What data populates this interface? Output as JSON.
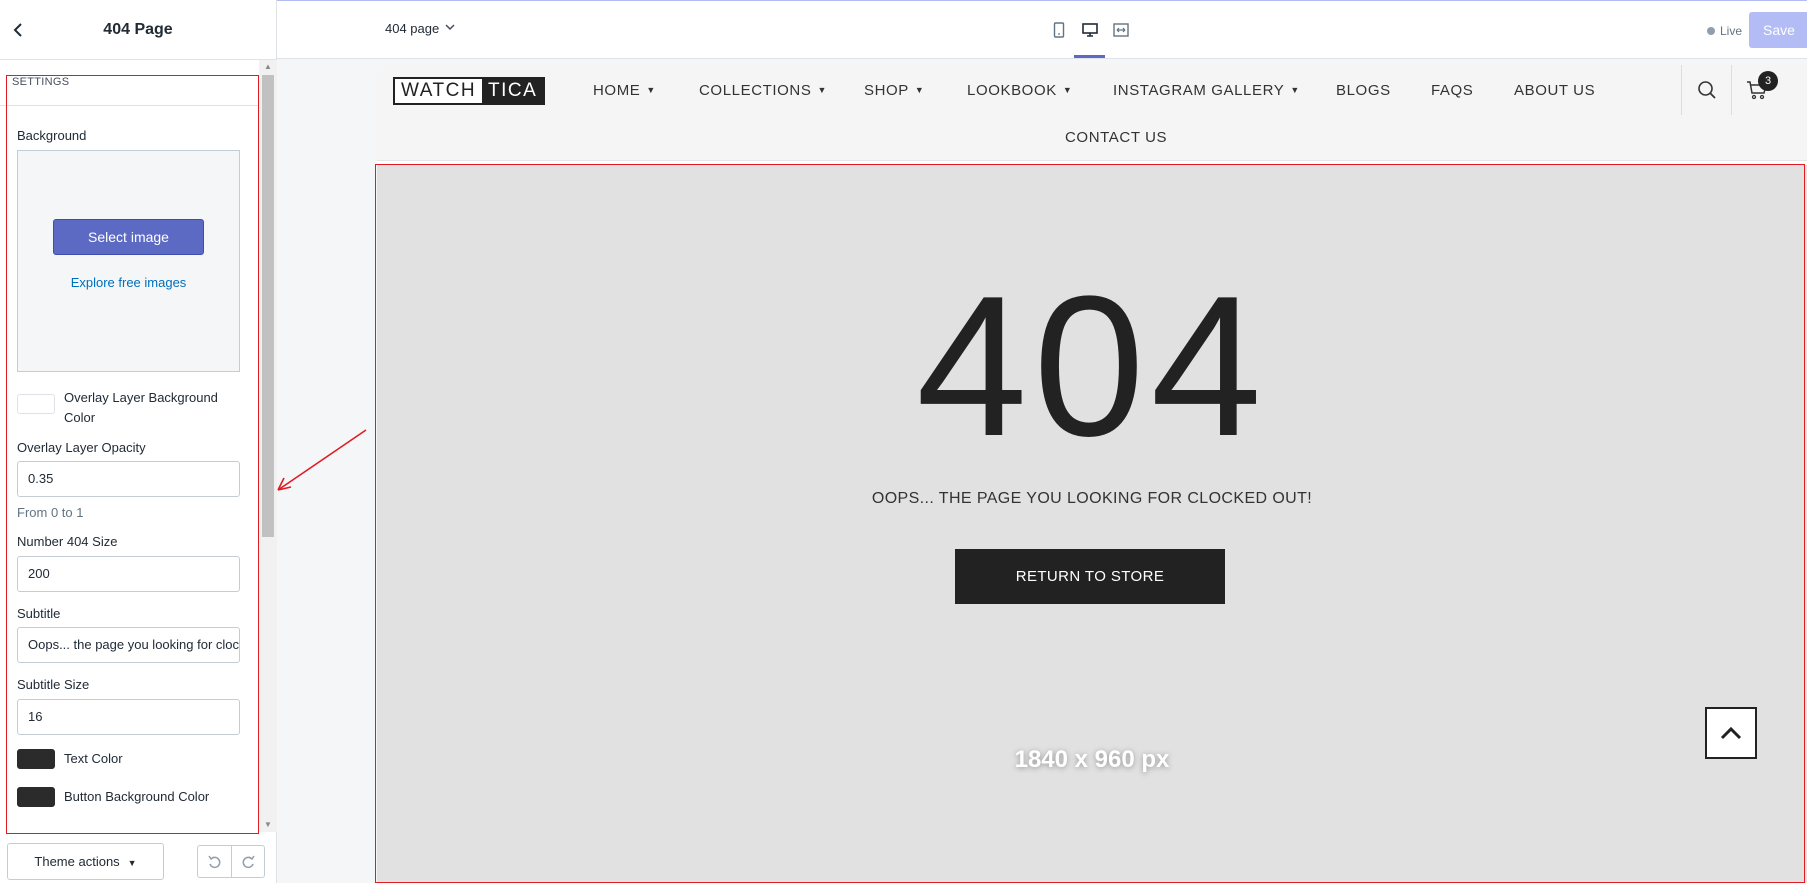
{
  "sidebar": {
    "back_icon": "chevron-left-icon",
    "title": "404 Page",
    "section_heading": "SETTINGS",
    "background": {
      "label": "Background",
      "select_button": "Select image",
      "explore_link": "Explore free images"
    },
    "overlay_color": {
      "label": "Overlay Layer Background Color",
      "color": "#ffffff"
    },
    "overlay_opacity": {
      "label": "Overlay Layer Opacity",
      "value": "0.35",
      "help": "From 0 to 1"
    },
    "number_size": {
      "label": "Number 404 Size",
      "value": "200"
    },
    "subtitle": {
      "label": "Subtitle",
      "value": "Oops... the page you looking for clocked out!"
    },
    "subtitle_size": {
      "label": "Subtitle Size",
      "value": "16"
    },
    "text_color": {
      "label": "Text Color",
      "color": "#2b2b2b"
    },
    "button_bg_color": {
      "label": "Button Background Color",
      "color": "#2b2b2b"
    },
    "footer": {
      "theme_actions": "Theme actions"
    }
  },
  "topbar": {
    "page_selector": "404 page",
    "devices": [
      "mobile-icon",
      "desktop-icon",
      "full-width-icon"
    ],
    "live_label": "Live",
    "save_label": "Save",
    "accent": "#5c6ac4"
  },
  "store": {
    "logo_left": "WATCH",
    "logo_right": "TICA",
    "nav": {
      "home": "HOME",
      "collections": "COLLECTIONS",
      "shop": "SHOP",
      "lookbook": "LOOKBOOK",
      "instagram": "INSTAGRAM GALLERY",
      "blogs": "BLOGS",
      "faqs": "FAQS",
      "about": "ABOUT US",
      "contact": "CONTACT US"
    },
    "cart_count": "3",
    "hero": {
      "number": "404",
      "subtitle": "OOPS... THE PAGE YOU LOOKING FOR CLOCKED OUT!",
      "button": "RETURN TO STORE",
      "placeholder": "1840 x 960 px"
    }
  }
}
